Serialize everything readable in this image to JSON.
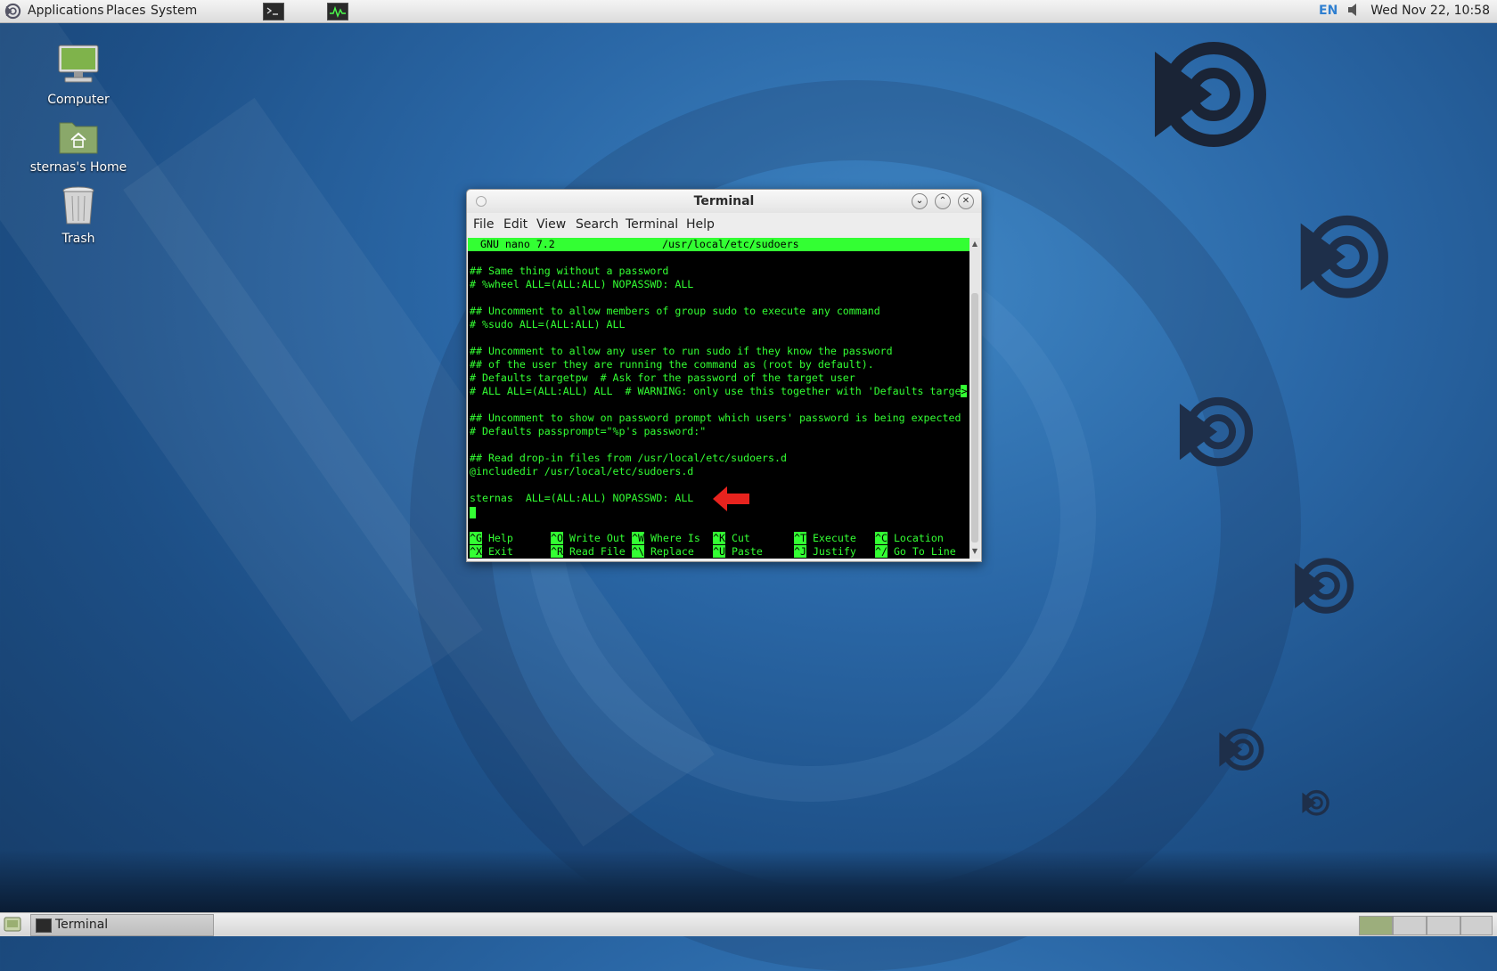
{
  "top_panel": {
    "menus": [
      "Applications",
      "Places",
      "System"
    ],
    "keyboard_layout": "EN",
    "clock": "Wed Nov 22, 10:58"
  },
  "desktop": {
    "icons": [
      "Computer",
      "sternas's Home",
      "Trash"
    ]
  },
  "window": {
    "title": "Terminal",
    "menus": [
      "File",
      "Edit",
      "View",
      "Search",
      "Terminal",
      "Help"
    ]
  },
  "nano": {
    "version": "GNU nano 7.2",
    "file": "/usr/local/etc/sudoers",
    "lines": [
      "",
      "## Same thing without a password",
      "# %wheel ALL=(ALL:ALL) NOPASSWD: ALL",
      "",
      "## Uncomment to allow members of group sudo to execute any command",
      "# %sudo ALL=(ALL:ALL) ALL",
      "",
      "## Uncomment to allow any user to run sudo if they know the password",
      "## of the user they are running the command as (root by default).",
      "# Defaults targetpw  # Ask for the password of the target user",
      "# ALL ALL=(ALL:ALL) ALL  # WARNING: only use this together with 'Defaults targe",
      "",
      "## Uncomment to show on password prompt which users' password is being expected",
      "# Defaults passprompt=\"%p's password:\"",
      "",
      "## Read drop-in files from /usr/local/etc/sudoers.d",
      "@includedir /usr/local/etc/sudoers.d",
      "",
      "sternas  ALL=(ALL:ALL) NOPASSWD: ALL"
    ],
    "overflow_marker": ">",
    "shortcuts": [
      {
        "key": "^G",
        "label": "Help"
      },
      {
        "key": "^O",
        "label": "Write Out"
      },
      {
        "key": "^W",
        "label": "Where Is"
      },
      {
        "key": "^K",
        "label": "Cut"
      },
      {
        "key": "^T",
        "label": "Execute"
      },
      {
        "key": "^C",
        "label": "Location"
      },
      {
        "key": "^X",
        "label": "Exit"
      },
      {
        "key": "^R",
        "label": "Read File"
      },
      {
        "key": "^\\",
        "label": "Replace"
      },
      {
        "key": "^U",
        "label": "Paste"
      },
      {
        "key": "^J",
        "label": "Justify"
      },
      {
        "key": "^/",
        "label": "Go To Line"
      }
    ]
  },
  "taskbar": {
    "items": [
      "Terminal"
    ]
  },
  "colors": {
    "terminal_text": "#33ff33",
    "terminal_bg": "#000000",
    "annotation_arrow": "#e8231e"
  }
}
